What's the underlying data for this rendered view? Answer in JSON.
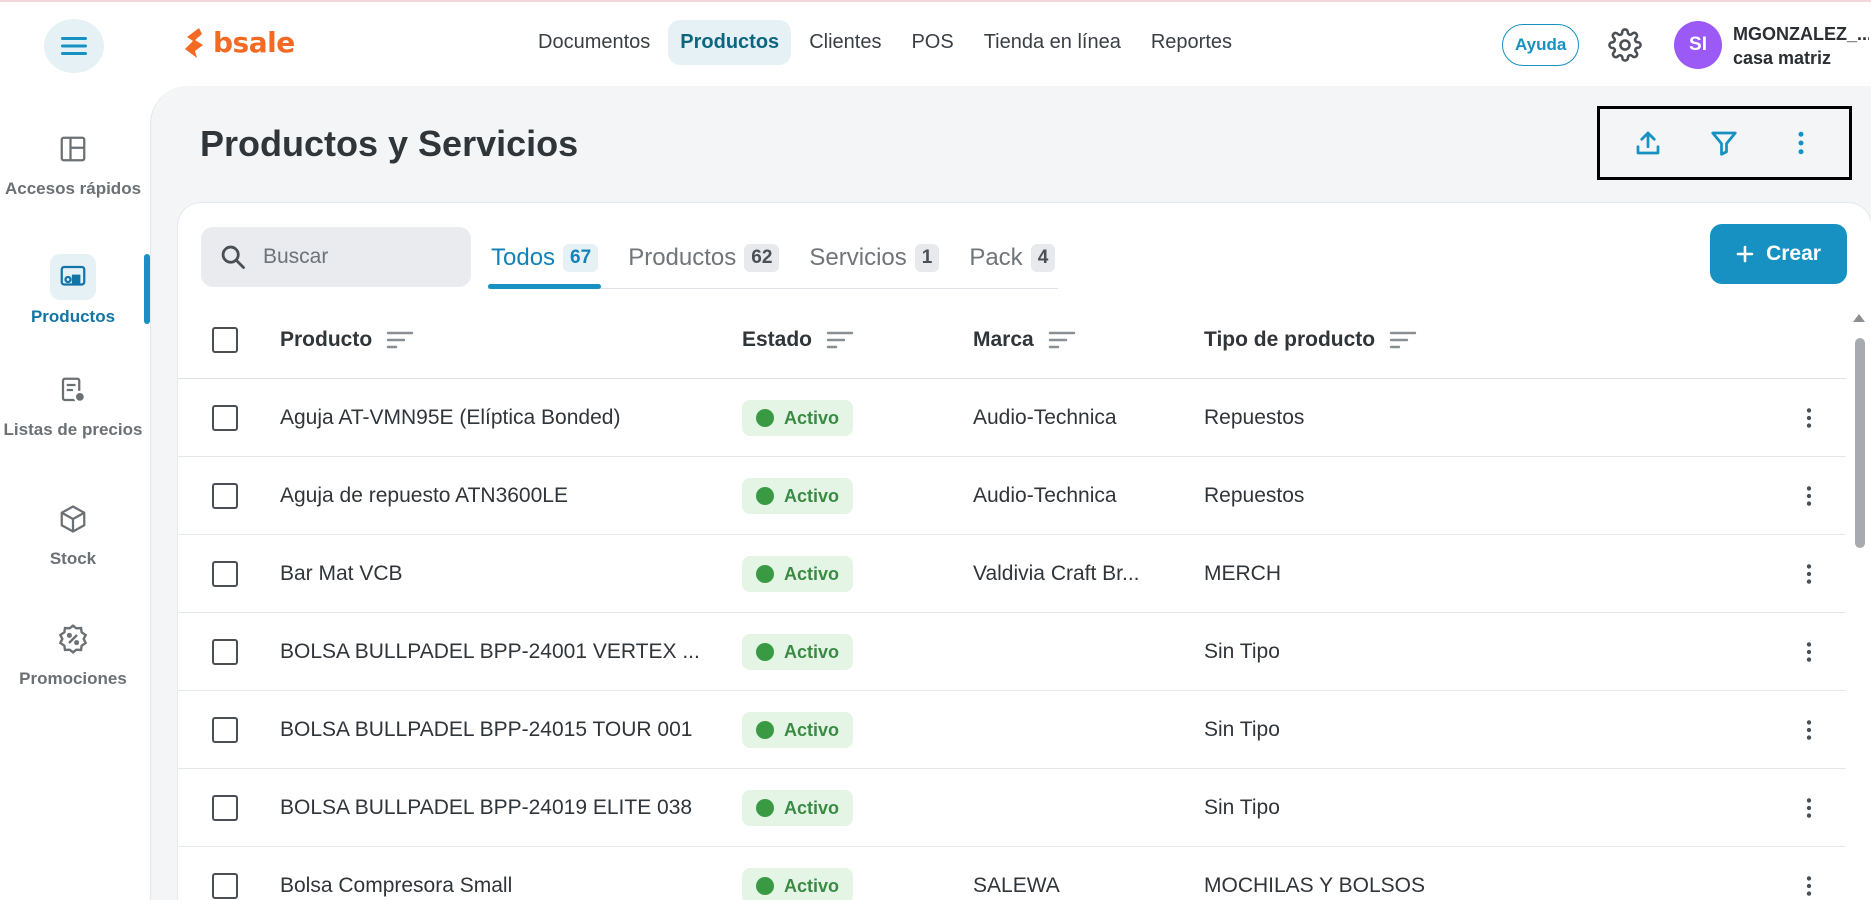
{
  "brand": {
    "logo_text": "bsale",
    "logo_color": "#f26a24",
    "accent": "#1791c2"
  },
  "topnav": {
    "items": [
      {
        "label": "Documentos"
      },
      {
        "label": "Productos",
        "active": true
      },
      {
        "label": "Clientes"
      },
      {
        "label": "POS"
      },
      {
        "label": "Tienda en línea"
      },
      {
        "label": "Reportes"
      }
    ],
    "help_label": "Ayuda",
    "settings_icon": "gear-icon",
    "user": {
      "initials": "SI",
      "name": "MGONZALEZ_...",
      "branch": "casa matriz",
      "avatar_color": "#9b59f6"
    }
  },
  "sidebar": {
    "items": [
      {
        "label": "Accesos rápidos",
        "icon": "layout-icon"
      },
      {
        "label": "Productos",
        "icon": "product-icon",
        "active": true
      },
      {
        "label": "Listas de precios",
        "icon": "price-list-icon"
      },
      {
        "label": "Stock",
        "icon": "box-icon"
      },
      {
        "label": "Promociones",
        "icon": "discount-icon"
      }
    ]
  },
  "page": {
    "title": "Productos y Servicios"
  },
  "actions": {
    "icons": [
      "upload-icon",
      "filter-icon",
      "more-vertical-icon"
    ]
  },
  "search": {
    "placeholder": "Buscar",
    "value": ""
  },
  "tabs": [
    {
      "label": "Todos",
      "count": "67",
      "active": true
    },
    {
      "label": "Productos",
      "count": "62"
    },
    {
      "label": "Servicios",
      "count": "1"
    },
    {
      "label": "Pack",
      "count": "4"
    }
  ],
  "create_button": {
    "label": "Crear"
  },
  "table": {
    "columns": [
      "Producto",
      "Estado",
      "Marca",
      "Tipo de producto"
    ],
    "rows": [
      {
        "product": "Aguja AT-VMN95E (Elíptica Bonded)",
        "status": "Activo",
        "brand": "Audio-Technica",
        "type": "Repuestos"
      },
      {
        "product": "Aguja de repuesto ATN3600LE",
        "status": "Activo",
        "brand": "Audio-Technica",
        "type": "Repuestos"
      },
      {
        "product": "Bar Mat VCB",
        "status": "Activo",
        "brand": "Valdivia Craft Br...",
        "type": "MERCH"
      },
      {
        "product": "BOLSA BULLPADEL BPP-24001 VERTEX ...",
        "status": "Activo",
        "brand": "",
        "type": "Sin Tipo"
      },
      {
        "product": "BOLSA BULLPADEL BPP-24015 TOUR 001",
        "status": "Activo",
        "brand": "",
        "type": "Sin Tipo"
      },
      {
        "product": "BOLSA BULLPADEL BPP-24019 ELITE 038",
        "status": "Activo",
        "brand": "",
        "type": "Sin Tipo"
      },
      {
        "product": "Bolsa Compresora Small",
        "status": "Activo",
        "brand": "SALEWA",
        "type": "MOCHILAS Y BOLSOS"
      }
    ]
  }
}
